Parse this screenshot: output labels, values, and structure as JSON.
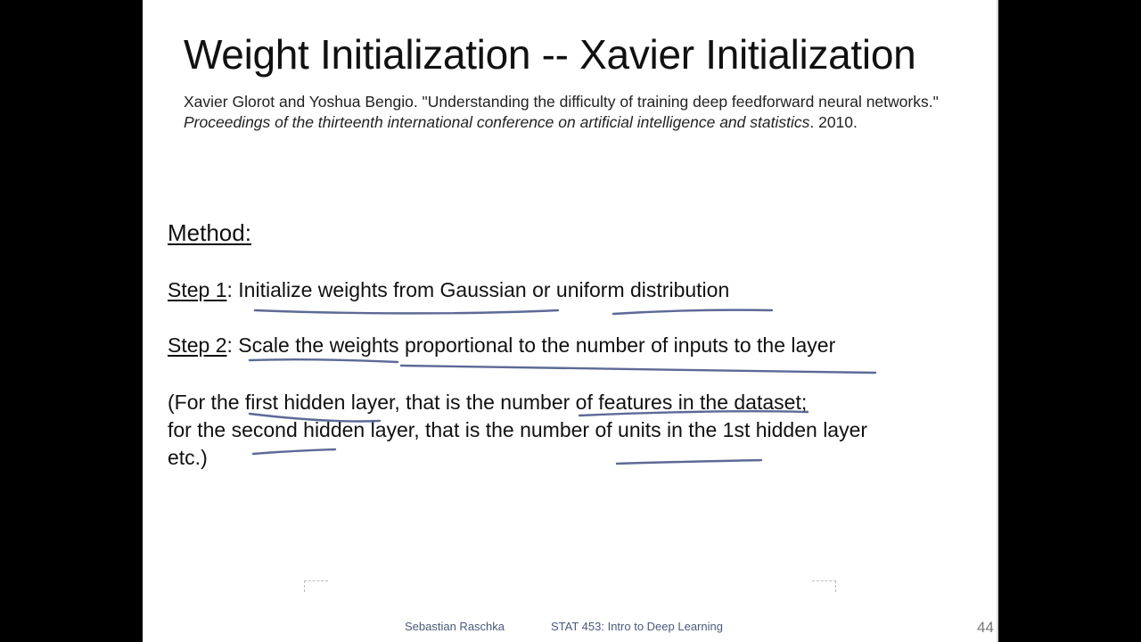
{
  "slide": {
    "title": "Weight Initialization -- Xavier Initialization",
    "citation": {
      "authors": "Xavier Glorot and Yoshua Bengio. \"Understanding the difficulty of training deep feedforward neural networks.\"",
      "venue": "Proceedings of the thirteenth international conference on artificial intelligence and statistics",
      "year": ". 2010."
    },
    "method_heading": "Method:",
    "step1": {
      "label": "Step 1",
      "text": ": Initialize weights from Gaussian or uniform distribution"
    },
    "step2": {
      "label": "Step 2",
      "text": ": Scale the weights proportional to the number of inputs to the layer"
    },
    "note": {
      "line1": "(For the first hidden layer, that is the number of features in the dataset;",
      "line2": "for the second hidden layer, that is the number of units in the 1st hidden layer",
      "line3": "etc.)"
    }
  },
  "footer": {
    "author": "Sebastian Raschka",
    "course": "STAT 453: Intro to Deep Learning",
    "page_number": "44"
  },
  "colors": {
    "annotation_ink": "#4a5a8c",
    "footer_text": "#4a5a7a",
    "background": "#000000",
    "slide": "#ffffff"
  }
}
